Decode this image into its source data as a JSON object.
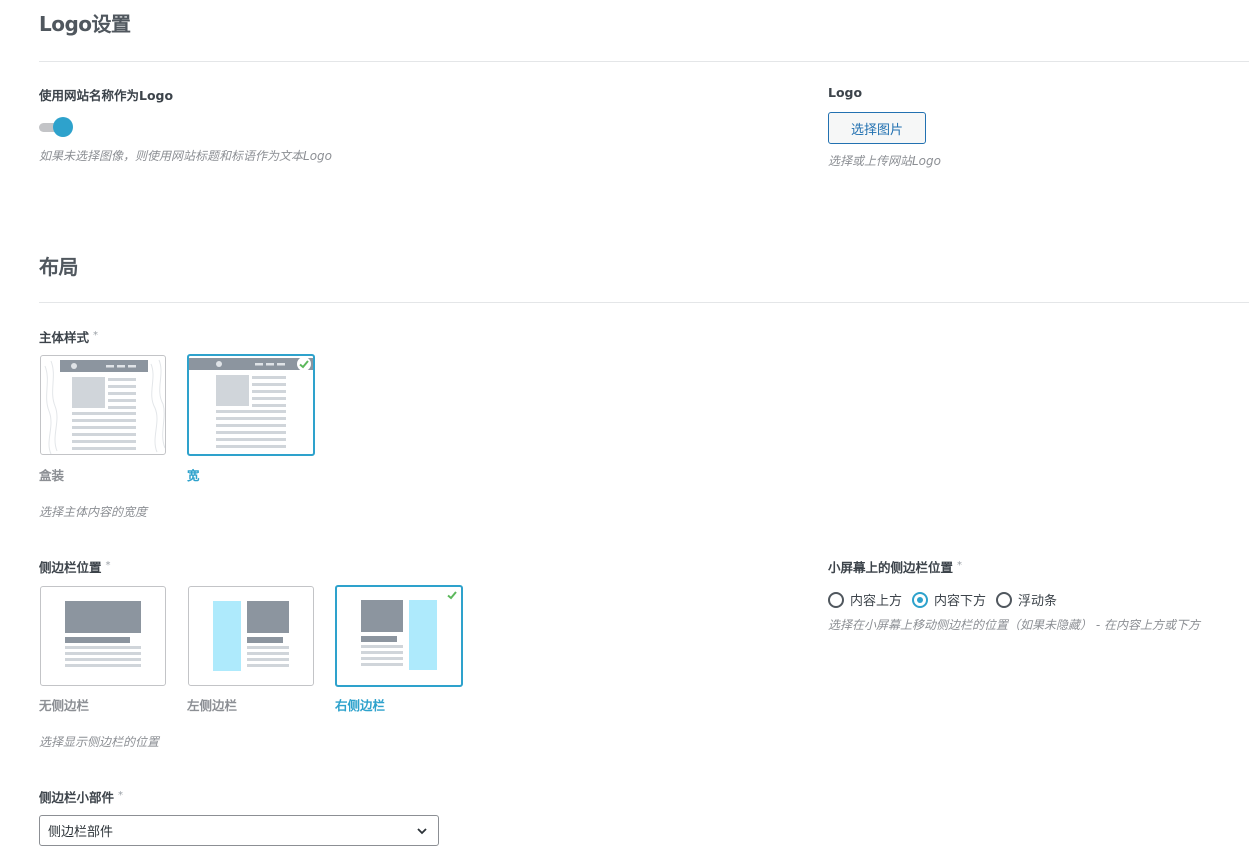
{
  "logo_section": {
    "title": "Logo设置",
    "use_site_name": {
      "label": "使用网站名称作为Logo",
      "enabled": true,
      "description": "如果未选择图像，则使用网站标题和标语作为文本Logo"
    },
    "logo": {
      "label": "Logo",
      "button": "选择图片",
      "description": "选择或上传网站Logo"
    }
  },
  "layout_section": {
    "title": "布局",
    "body_style": {
      "label": "主体样式",
      "required_mark": "*",
      "options": [
        {
          "label": "盒装",
          "selected": false
        },
        {
          "label": "宽",
          "selected": true
        }
      ],
      "description": "选择主体内容的宽度"
    },
    "sidebar_position": {
      "label": "侧边栏位置",
      "required_mark": "*",
      "options": [
        {
          "label": "无侧边栏",
          "selected": false
        },
        {
          "label": "左侧边栏",
          "selected": false
        },
        {
          "label": "右侧边栏",
          "selected": true
        }
      ],
      "description": "选择显示侧边栏的位置"
    },
    "mobile_sidebar": {
      "label": "小屏幕上的侧边栏位置",
      "required_mark": "*",
      "options": [
        {
          "label": "内容上方",
          "checked": false
        },
        {
          "label": "内容下方",
          "checked": true
        },
        {
          "label": "浮动条",
          "checked": false
        }
      ],
      "description": "选择在小屏幕上移动侧边栏的位置（如果未隐藏） - 在内容上方或下方"
    },
    "sidebar_widget": {
      "label": "侧边栏小部件",
      "required_mark": "*",
      "selected_value": "侧边栏部件"
    }
  },
  "colors": {
    "accent": "#2ea2cc",
    "check": "#5cb85c",
    "thumb_bar": "#8c959f",
    "thumb_block": "#d0d5da",
    "sidebar_fill": "#aeeafc"
  }
}
